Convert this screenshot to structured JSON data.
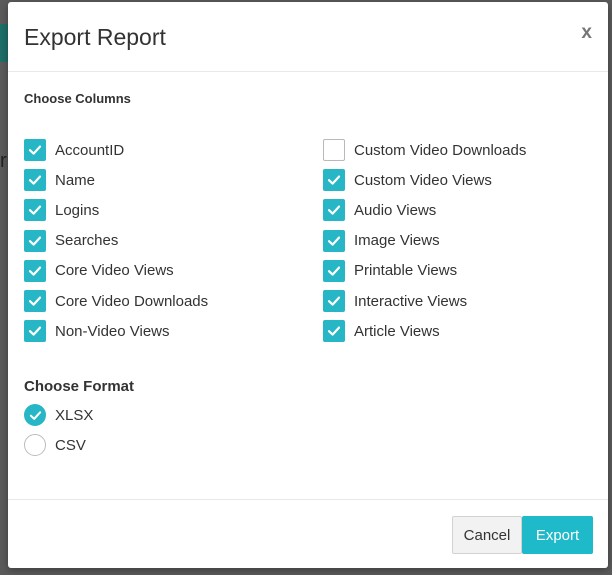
{
  "modal": {
    "title": "Export Report",
    "close_label": "x",
    "columns_title": "Choose Columns",
    "format_title": "Choose Format",
    "columns_left": [
      {
        "label": "AccountID",
        "checked": true
      },
      {
        "label": "Name",
        "checked": true
      },
      {
        "label": "Logins",
        "checked": true
      },
      {
        "label": "Searches",
        "checked": true
      },
      {
        "label": "Core Video Views",
        "checked": true
      },
      {
        "label": "Core Video Downloads",
        "checked": true
      },
      {
        "label": "Non-Video Views",
        "checked": true
      }
    ],
    "columns_right": [
      {
        "label": "Custom Video Downloads",
        "checked": false
      },
      {
        "label": "Custom Video Views",
        "checked": true
      },
      {
        "label": "Audio Views",
        "checked": true
      },
      {
        "label": "Image Views",
        "checked": true
      },
      {
        "label": "Printable Views",
        "checked": true
      },
      {
        "label": "Interactive Views",
        "checked": true
      },
      {
        "label": "Article Views",
        "checked": true
      }
    ],
    "formats": [
      {
        "label": "XLSX",
        "selected": true
      },
      {
        "label": "CSV",
        "selected": false
      }
    ],
    "cancel_label": "Cancel",
    "export_label": "Export"
  },
  "colors": {
    "accent": "#27b6c6",
    "export_button": "#1fbac9",
    "overlay": "#5b5b5b"
  },
  "icons": {
    "check": "check-icon",
    "close": "close-icon",
    "radio_check": "radio-check-icon"
  }
}
